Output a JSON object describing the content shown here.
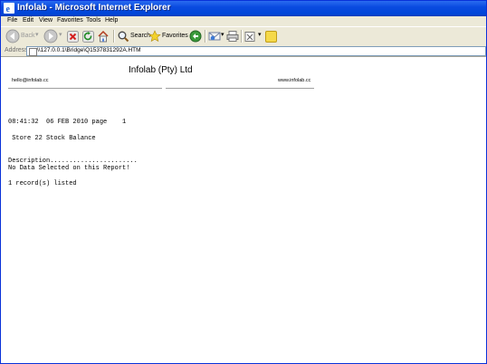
{
  "window": {
    "title": "Infolab - Microsoft Internet Explorer"
  },
  "menu": [
    {
      "label": "File",
      "u": "F"
    },
    {
      "label": "Edit",
      "u": "E"
    },
    {
      "label": "View",
      "u": "V"
    },
    {
      "label": "Favorites",
      "u": "a"
    },
    {
      "label": "Tools",
      "u": "T"
    },
    {
      "label": "Help",
      "u": "H"
    }
  ],
  "toolbar": {
    "back_label": "Back",
    "search_label": "Search",
    "favorites_label": "Favorites"
  },
  "address": {
    "label": "Address",
    "value": "\\\\127.0.0.1\\Bridge\\Q1537831292A.HTM"
  },
  "report": {
    "company": "Infolab (Pty) Ltd",
    "email": "hello@infolab.cc",
    "website": "www.infolab.cc",
    "line_datetime": "08:41:32  06 FEB 2010 page    1",
    "line_title": " Store 22 Stock Balance",
    "line_description": "Description.......................",
    "line_nodata": "No Data Selected on this Report!",
    "line_records": "1 record(s) listed"
  },
  "colors": {
    "titlebar": "#0a4be0",
    "chrome": "#ece9d8"
  }
}
